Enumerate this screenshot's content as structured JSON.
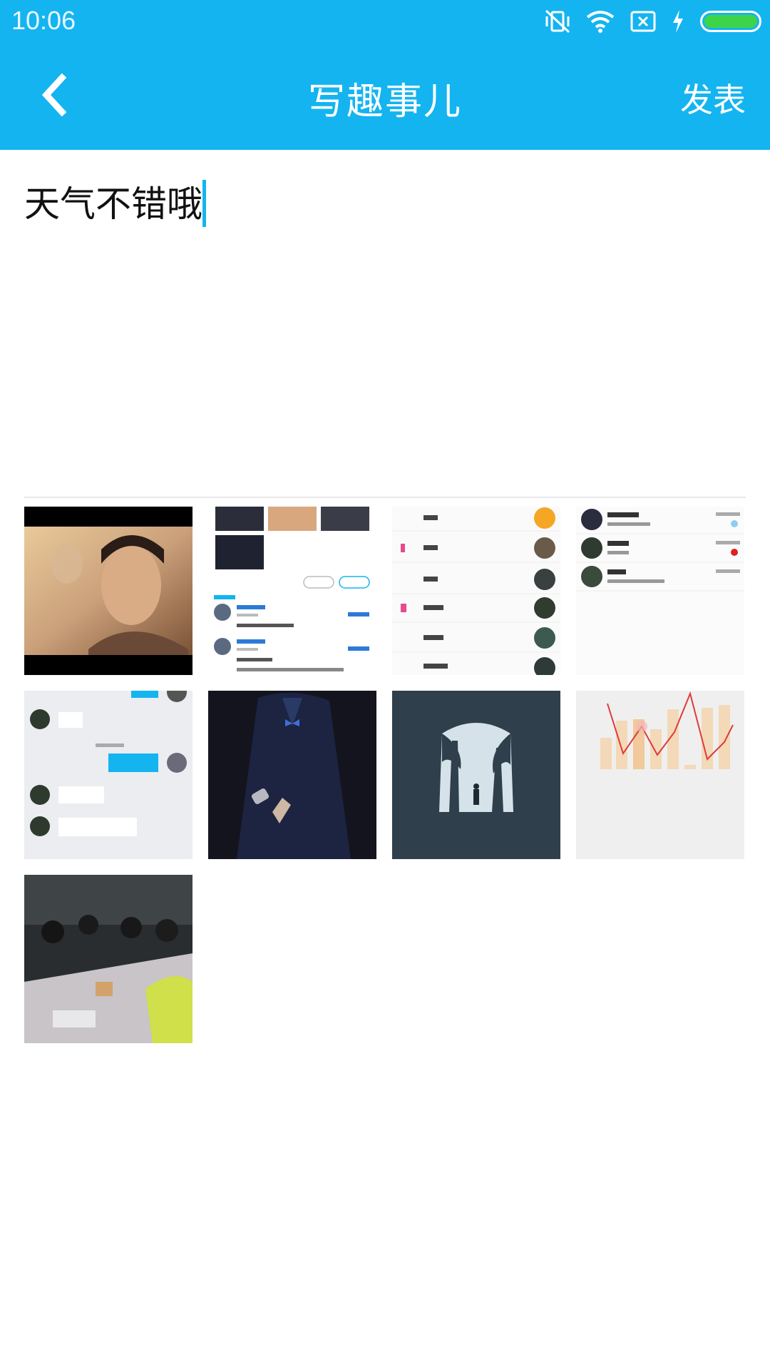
{
  "status_bar": {
    "time": "10:06"
  },
  "app_bar": {
    "title": "写趣事儿",
    "publish_label": "发表"
  },
  "composer": {
    "text": "天气不错哦"
  },
  "photos": [
    {
      "name": "photo-portrait-poster"
    },
    {
      "name": "photo-comments-screenshot"
    },
    {
      "name": "photo-contacts-list"
    },
    {
      "name": "photo-chat-list"
    },
    {
      "name": "photo-chat-conversation"
    },
    {
      "name": "photo-man-in-suit"
    },
    {
      "name": "photo-forest-illustration"
    },
    {
      "name": "photo-chart"
    },
    {
      "name": "photo-meeting-room"
    }
  ],
  "colors": {
    "accent": "#14b4f0",
    "battery": "#3ed44a"
  },
  "icons": [
    "vibrate-off-icon",
    "wifi-icon",
    "no-sim-icon",
    "charging-icon",
    "battery-icon",
    "back-arrow-icon"
  ]
}
